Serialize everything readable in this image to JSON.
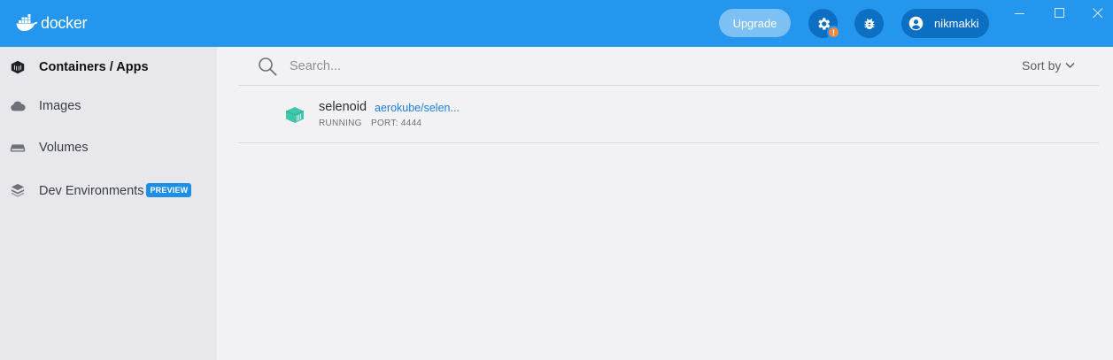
{
  "app": {
    "logo_text": "docker",
    "accent_color": "#2496ed",
    "upgrade_label": "Upgrade",
    "username": "nikmakki",
    "settings_badge": "!"
  },
  "sidebar": {
    "items": [
      {
        "label": "Containers / Apps",
        "icon": "container-cube-icon",
        "active": true
      },
      {
        "label": "Images",
        "icon": "cloud-icon",
        "active": false
      },
      {
        "label": "Volumes",
        "icon": "volume-drive-icon",
        "active": false
      },
      {
        "label": "Dev Environments",
        "icon": "dev-environments-icon",
        "active": false,
        "badge": "PREVIEW"
      }
    ]
  },
  "main": {
    "search": {
      "placeholder": "Search...",
      "value": ""
    },
    "sort_label": "Sort by",
    "containers": [
      {
        "name": "selenoid",
        "image": "aerokube/selen...",
        "status": "RUNNING",
        "port": "PORT: 4444",
        "status_color": "#3ec7a8"
      }
    ]
  }
}
